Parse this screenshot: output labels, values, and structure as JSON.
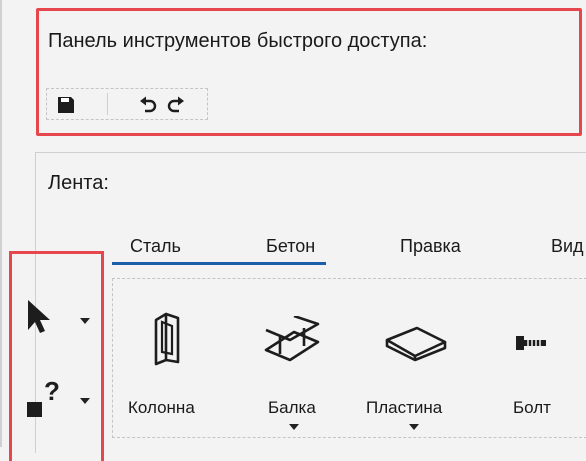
{
  "quick_access": {
    "label": "Панель инструментов быстрого доступа:",
    "buttons": [
      "save-icon",
      "undo-icon",
      "redo-icon"
    ]
  },
  "ribbon": {
    "label": "Лента:",
    "tabs": [
      {
        "label": "Сталь",
        "active": true
      },
      {
        "label": "Бетон",
        "active": true
      },
      {
        "label": "Правка",
        "active": false
      },
      {
        "label": "Вид",
        "active": false
      }
    ],
    "tools": [
      {
        "label": "Колонна",
        "icon": "column-icon",
        "has_dropdown": false
      },
      {
        "label": "Балка",
        "icon": "beam-icon",
        "has_dropdown": true
      },
      {
        "label": "Пластина",
        "icon": "plate-icon",
        "has_dropdown": true
      },
      {
        "label": "Болт",
        "icon": "bolt-icon",
        "has_dropdown": false
      }
    ],
    "side_buttons": [
      {
        "icon": "select-arrow-icon",
        "has_dropdown": true
      },
      {
        "icon": "query-icon",
        "has_dropdown": true
      }
    ]
  },
  "colors": {
    "highlight_frame": "#e5474d",
    "tab_underline": "#1b5fa8"
  }
}
